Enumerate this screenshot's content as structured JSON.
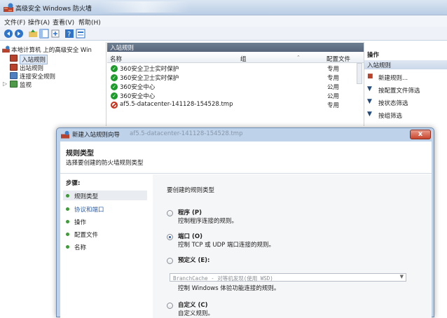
{
  "window": {
    "title": "高级安全 Windows 防火墙"
  },
  "menubar": [
    "文件(F)",
    "操作(A)",
    "查看(V)",
    "帮助(H)"
  ],
  "tree": {
    "root": "本地计算机 上的高级安全 Win",
    "items": [
      "入站规则",
      "出站规则",
      "连接安全规则",
      "监视"
    ]
  },
  "center": {
    "header": "入站规则",
    "columns": {
      "name": "名称",
      "group": "组",
      "profile": "配置文件"
    },
    "rows": [
      {
        "name": "360安全卫士实时保护",
        "profile": "专用",
        "status": "allow"
      },
      {
        "name": "360安全卫士实时保护",
        "profile": "专用",
        "status": "allow"
      },
      {
        "name": "360安全中心",
        "profile": "公用",
        "status": "allow"
      },
      {
        "name": "360安全中心",
        "profile": "公用",
        "status": "allow"
      },
      {
        "name": "af5.5-datacenter-141128-154528.tmp",
        "profile": "专用",
        "status": "block"
      }
    ]
  },
  "actions": {
    "header": "操作",
    "section": "入站规则",
    "items": [
      "新建规则...",
      "按配置文件筛选",
      "按状态筛选",
      "按组筛选"
    ]
  },
  "dialog": {
    "title": "新建入站规则向导",
    "ghost_title": "af5.5-datacenter-141128-154528.tmp",
    "heading": "规则类型",
    "subheading": "选择要创建的防火墙规则类型",
    "steps_label": "步骤:",
    "steps": [
      "规则类型",
      "协议和端口",
      "操作",
      "配置文件",
      "名称"
    ],
    "question": "要创建的规则类型",
    "options": [
      {
        "label": "程序 (P)",
        "desc": "控制程序连接的规则。",
        "selected": false
      },
      {
        "label": "端口 (O)",
        "desc": "控制 TCP 或 UDP 端口连接的规则。",
        "selected": true
      },
      {
        "label": "预定义 (E):",
        "desc": "控制 Windows 体验功能连接的规则。",
        "selected": false
      },
      {
        "label": "自定义 (C)",
        "desc": "自定义规则。",
        "selected": false
      }
    ],
    "predefined_value": "BranchCache - 对等机发现(使用 WSD)",
    "close_label": "x"
  },
  "colors": {
    "allow": "#1c9a2a",
    "block": "#c8321c",
    "step_active": "#3f9a3a",
    "step_link": "#2a5ba6"
  }
}
